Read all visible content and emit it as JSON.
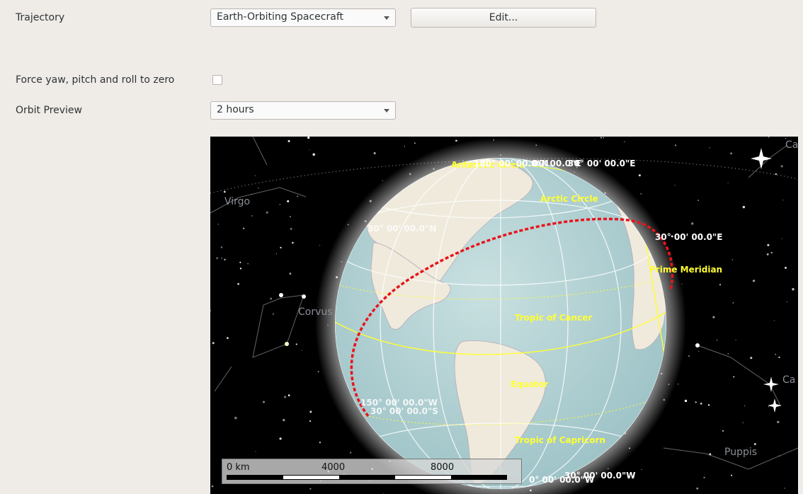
{
  "form": {
    "trajectory_label": "Trajectory",
    "trajectory_value": "Earth-Orbiting Spacecraft",
    "edit_button": "Edit...",
    "force_label": "Force yaw, pitch and roll to zero",
    "force_checked": false,
    "preview_label": "Orbit Preview",
    "preview_value": "2 hours"
  },
  "map": {
    "constellations": {
      "virgo": "Virgo",
      "corvus": "Corvus",
      "puppis": "Puppis",
      "canis": "Canis",
      "ca": "Ca"
    },
    "overlay_labels": {
      "antarctic_circle_top": "Antarctic Circle",
      "north_pole_label": "180° 00' 00.0\"N",
      "top_meridian": "00' 00.0\"E",
      "top_meridian_right": "30° 00' 00.0\"E",
      "arctic_circle": "Arctic Circle",
      "lat_30n": "30° 00' 00.0\"N",
      "lon_30e": "30° 00' 00.0\"E",
      "prime_meridian": "Prime Meridian",
      "tropic_cancer": "Tropic of Cancer",
      "equator": "Equator",
      "lon_150w": "150° 00' 00.0\"W",
      "lat_30s": "30° 00' 00.0\"S",
      "tropic_capricorn": "Tropic of Capricorn",
      "bottom_w1": "0° 00' 00.0\"W",
      "bottom_w2": "30° 00' 00.0\"W"
    },
    "scale": {
      "t0": "0 km",
      "t1": "4000",
      "t2": "8000"
    },
    "colors": {
      "orbit": "#e8141b",
      "grid_yellow": "#ffff33",
      "ocean": "#b9d6d8"
    }
  }
}
